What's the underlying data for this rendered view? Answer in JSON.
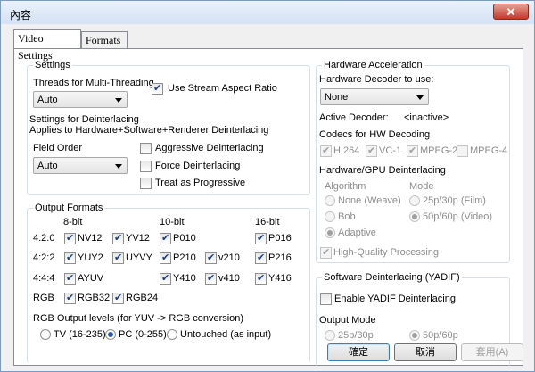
{
  "window": {
    "title": "內容",
    "close_glyph": "✕"
  },
  "tabs": [
    {
      "label": "Video Settings"
    },
    {
      "label": "Formats"
    }
  ],
  "settings": {
    "group_title": "Settings",
    "threads_label": "Threads for Multi-Threading",
    "threads_value": "Auto",
    "stream_aspect_label": "Use Stream Aspect Ratio",
    "deint_title": "Settings for Deinterlacing",
    "deint_sub": "Applies to Hardware+Software+Renderer Deinterlacing",
    "field_order_label": "Field Order",
    "field_order_value": "Auto",
    "aggressive_label": "Aggressive Deinterlacing",
    "force_label": "Force Deinterlacing",
    "progressive_label": "Treat as Progressive"
  },
  "output_formats": {
    "group_title": "Output Formats",
    "col_8bit": "8-bit",
    "col_10bit": "10-bit",
    "col_16bit": "16-bit",
    "row_420": "4:2:0",
    "row_422": "4:2:2",
    "row_444": "4:4:4",
    "row_rgb": "RGB",
    "nv12": "NV12",
    "yv12": "YV12",
    "p010": "P010",
    "p016": "P016",
    "yuy2": "YUY2",
    "uyvy": "UYVY",
    "p210": "P210",
    "v210": "v210",
    "p216": "P216",
    "ayuv": "AYUV",
    "y410": "Y410",
    "v410": "v410",
    "y416": "Y416",
    "rgb32": "RGB32",
    "rgb24": "RGB24",
    "levels_label": "RGB Output levels (for YUV -> RGB conversion)",
    "levels_tv": "TV (16-235)",
    "levels_pc": "PC (0-255)",
    "levels_untouched": "Untouched (as input)"
  },
  "hw": {
    "group_title": "Hardware Acceleration",
    "decoder_label": "Hardware Decoder to use:",
    "decoder_value": "None",
    "active_label": "Active Decoder:",
    "active_value": "<inactive>",
    "codecs_label": "Codecs for HW Decoding",
    "h264": "H.264",
    "vc1": "VC-1",
    "mpeg2": "MPEG-2",
    "mpeg4": "MPEG-4",
    "deint_label": "Hardware/GPU Deinterlacing",
    "algo_label": "Algorithm",
    "mode_label": "Mode",
    "algo_none": "None (Weave)",
    "algo_bob": "Bob",
    "algo_adaptive": "Adaptive",
    "mode_25p": "25p/30p (Film)",
    "mode_50p": "50p/60p (Video)",
    "hq_label": "High-Quality Processing"
  },
  "sw": {
    "group_title": "Software Deinterlacing (YADIF)",
    "enable_label": "Enable YADIF Deinterlacing",
    "output_mode_label": "Output Mode",
    "mode_25p": "25p/30p",
    "mode_50p": "50p/60p"
  },
  "buttons": {
    "ok": "確定",
    "cancel": "取消",
    "apply": "套用(A)"
  },
  "colors": {
    "accent": "#2a5ab0",
    "group_border": "#d5dfe5"
  }
}
